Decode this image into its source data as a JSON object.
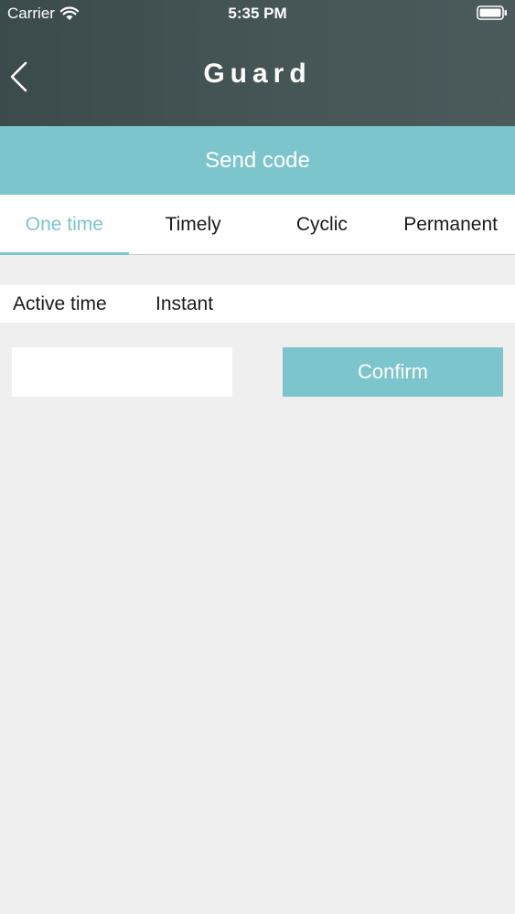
{
  "status_bar": {
    "carrier": "Carrier",
    "time": "5:35 PM",
    "wifi_icon": "wifi-icon",
    "battery_icon": "battery-icon"
  },
  "nav": {
    "title": "Guard",
    "back_icon": "chevron-left-icon"
  },
  "send_code": {
    "label": "Send code"
  },
  "tabs": [
    {
      "label": "One time",
      "active": true
    },
    {
      "label": "Timely",
      "active": false
    },
    {
      "label": "Cyclic",
      "active": false
    },
    {
      "label": "Permanent",
      "active": false
    }
  ],
  "active_time": {
    "label": "Active time",
    "value": "Instant"
  },
  "code_form": {
    "input_value": "",
    "confirm_label": "Confirm"
  },
  "colors": {
    "accent": "#7cc5cc",
    "header": "#455556",
    "background": "#efeff0"
  }
}
